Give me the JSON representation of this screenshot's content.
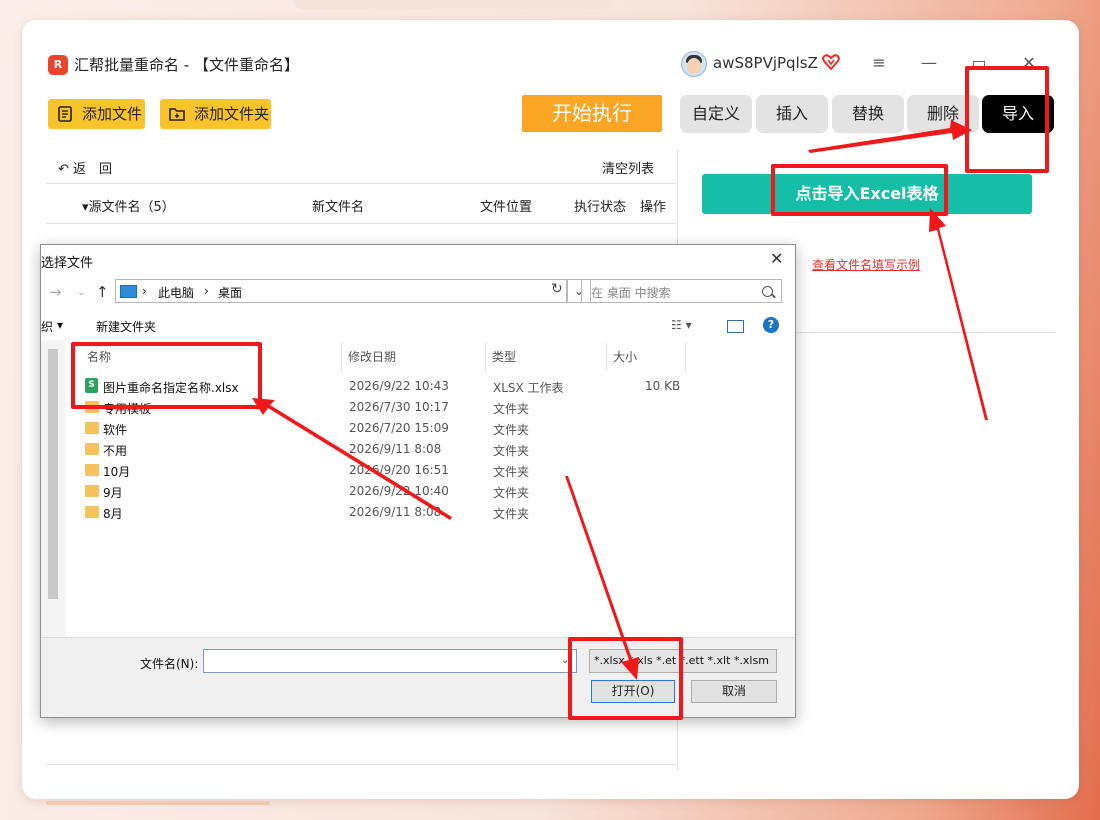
{
  "app": {
    "title": "汇帮批量重命名 - 【文件重命名】",
    "username": "awS8PVjPqlsZ",
    "logo_text": "R"
  },
  "toolbar": {
    "add_file": "添加文件",
    "add_folder": "添加文件夹",
    "start": "开始执行",
    "tabs": [
      "自定义",
      "插入",
      "替换",
      "删除"
    ],
    "import": "导入"
  },
  "list": {
    "undo": "返　回",
    "clear": "清空列表",
    "columns": {
      "source": "源文件名（5）",
      "new_name": "新文件名",
      "location": "文件位置",
      "status": "执行状态",
      "action": "操作"
    }
  },
  "right": {
    "import_excel": "点击导入Excel表格",
    "example_link": "查看文件名填写示例"
  },
  "dialog": {
    "title": "选择文件",
    "address": [
      "此电脑",
      "桌面"
    ],
    "search_placeholder": "在 桌面 中搜索",
    "organize": "组织",
    "new_folder": "新建文件夹",
    "columns": {
      "name": "名称",
      "modified": "修改日期",
      "type": "类型",
      "size": "大小"
    },
    "rows": [
      {
        "name": "图片重命名指定名称.xlsx",
        "modified": "2026/9/22 10:43",
        "type": "XLSX 工作表",
        "size": "10 KB",
        "kind": "xlsx"
      },
      {
        "name": "专用模板",
        "modified": "2026/7/30 10:17",
        "type": "文件夹",
        "size": "",
        "kind": "folder"
      },
      {
        "name": "软件",
        "modified": "2026/7/20 15:09",
        "type": "文件夹",
        "size": "",
        "kind": "folder"
      },
      {
        "name": "不用",
        "modified": "2026/9/11 8:08",
        "type": "文件夹",
        "size": "",
        "kind": "folder"
      },
      {
        "name": "10月",
        "modified": "2026/9/20 16:51",
        "type": "文件夹",
        "size": "",
        "kind": "folder"
      },
      {
        "name": "9月",
        "modified": "2026/9/22 10:40",
        "type": "文件夹",
        "size": "",
        "kind": "folder"
      },
      {
        "name": "8月",
        "modified": "2026/9/11 8:08",
        "type": "文件夹",
        "size": "",
        "kind": "folder"
      }
    ],
    "filename_label": "文件名(N):",
    "filename_value": "",
    "filetype": "*.xlsx *.xls *.et *.ett *.xlt *.xlsm",
    "open": "打开(O)",
    "cancel": "取消"
  },
  "colors": {
    "accent_orange": "#fba524",
    "accent_yellow": "#f9c42b",
    "teal": "#16bda7",
    "annotation_red": "#f0181a"
  }
}
